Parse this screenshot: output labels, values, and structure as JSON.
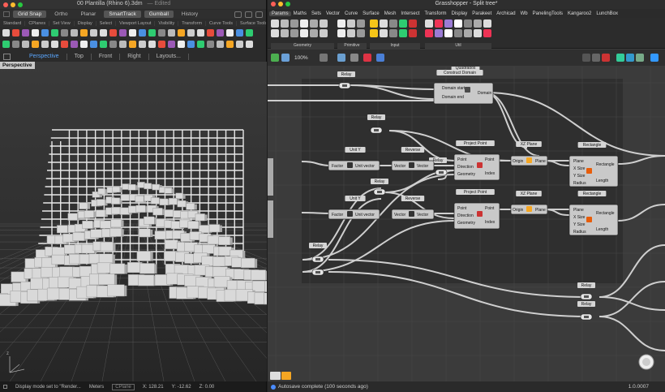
{
  "rhino": {
    "title": "00 Plantilla (Rhino 6).3dm",
    "title_suffix": "— Edited",
    "snap_buttons": [
      {
        "label": "Grid Snap",
        "active": true
      },
      {
        "label": "Ortho",
        "active": false
      },
      {
        "label": "Planar",
        "active": false
      },
      {
        "label": "SmartTrack",
        "active": true
      },
      {
        "label": "Gumball",
        "active": true
      },
      {
        "label": "History",
        "active": false
      }
    ],
    "toolbar_tabs": [
      "Standard",
      "CPlanes",
      "Set View",
      "Display",
      "Select",
      "Viewport Layout",
      "Visibility",
      "Transform",
      "Curve Tools",
      "Surface Tools"
    ],
    "view_tabs": [
      {
        "label": "Perspective",
        "active": true
      },
      {
        "label": "Top",
        "active": false
      },
      {
        "label": "Front",
        "active": false
      },
      {
        "label": "Right",
        "active": false
      },
      {
        "label": "Layouts...",
        "active": false
      }
    ],
    "viewport_label": "Perspective",
    "status": {
      "message": "Display mode set to \"Render...",
      "units": "Meters",
      "cplane": "CPlane",
      "x": "X: 128.21",
      "y": "Y: -12.62",
      "z": "Z: 0.00"
    }
  },
  "grasshopper": {
    "title": "Grasshopper - Split tree*",
    "menu": [
      "Params",
      "Maths",
      "Sets",
      "Vector",
      "Curve",
      "Surface",
      "Mesh",
      "Intersect",
      "Transform",
      "Display",
      "Parakeet",
      "Archicad",
      "Wb",
      "PanelingTools",
      "Kangaroo2",
      "LunchBox"
    ],
    "ribbon_groups": [
      "Geometry",
      "Primitive",
      "Input",
      "Util"
    ],
    "zoom": "100%",
    "nodes": {
      "relay": "Relay",
      "quadrados": "Quadrados",
      "construct_domain": "Construct Domain",
      "domain_start": "Domain start",
      "domain_end": "Domain end",
      "domain": "Domain",
      "unit_y": "Unit Y",
      "factor": "Factor",
      "unit_vector": "Unit vector",
      "reverse": "Reverse",
      "vector": "Vector",
      "project_point": "Project Point",
      "point": "Point",
      "direction": "Direction",
      "geometry": "Geometry",
      "index": "Index",
      "xz_plane": "XZ Plane",
      "origin": "Origin",
      "plane": "Plane",
      "rectangle": "Rectangle",
      "x_size": "X Size",
      "y_size": "Y Size",
      "radius": "Radius",
      "length": "Length"
    },
    "status": "Autosave complete (100 seconds ago)",
    "version": "1.0.0007"
  },
  "colors": {
    "accent_blue": "#5aa7ff",
    "node_body": "#c9c9c9",
    "canvas_bg": "#3b3b3b",
    "canvas_inner": "#2f2f2f"
  }
}
